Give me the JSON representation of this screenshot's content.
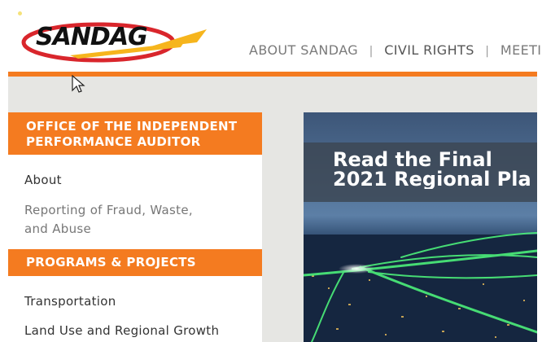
{
  "header": {
    "logo_text": "SANDAG",
    "nav": [
      {
        "label": "ABOUT SANDAG"
      },
      {
        "label": "CIVIL RIGHTS"
      },
      {
        "label": "MEETI"
      }
    ],
    "separator": "|"
  },
  "sidebar": {
    "section1_title_line1": "OFFICE OF THE INDEPENDENT",
    "section1_title_line2": "PERFORMANCE AUDITOR",
    "section1_links": [
      {
        "label": "About"
      },
      {
        "label_line1": "Reporting of Fraud, Waste,",
        "label_line2": "and Abuse"
      }
    ],
    "section2_title": "PROGRAMS & PROJECTS",
    "section2_links": [
      {
        "label": "Transportation"
      },
      {
        "label": "Land Use and Regional Growth"
      }
    ]
  },
  "hero": {
    "line1": "Read the Final",
    "line2": "2021 Regional Pla"
  },
  "colors": {
    "accent": "#f47b20",
    "body_bg": "#e6e6e3",
    "nav_text": "#7a7a7a"
  }
}
